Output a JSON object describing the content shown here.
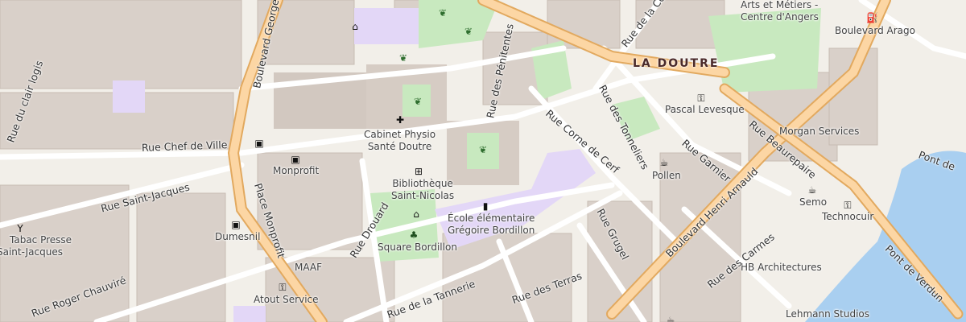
{
  "map": {
    "district": "LA DOUTRE",
    "places": [
      {
        "id": "arts",
        "lines": [
          "Arts et Métiers -",
          "Centre d'Angers"
        ]
      },
      {
        "id": "arago",
        "lines": [
          "Boulevard Arago"
        ]
      },
      {
        "id": "levesque",
        "lines": [
          "Pascal Levesque"
        ]
      },
      {
        "id": "morgan",
        "lines": [
          "Morgan Services"
        ]
      },
      {
        "id": "pollen",
        "lines": [
          "Pollen"
        ]
      },
      {
        "id": "semo",
        "lines": [
          "Semo"
        ]
      },
      {
        "id": "technocuir",
        "lines": [
          "Technocuir"
        ]
      },
      {
        "id": "hb",
        "lines": [
          "HB Architectures"
        ]
      },
      {
        "id": "lehmann",
        "lines": [
          "Lehmann Studios"
        ]
      },
      {
        "id": "cabinet",
        "lines": [
          "Cabinet Physio",
          "Santé Doutre"
        ]
      },
      {
        "id": "monprofit",
        "lines": [
          "Monprofit"
        ]
      },
      {
        "id": "bibliotheque",
        "lines": [
          "Bibliothèque",
          "Saint-Nicolas"
        ]
      },
      {
        "id": "ecole",
        "lines": [
          "École élémentaire",
          "Grégoire Bordillon"
        ]
      },
      {
        "id": "square",
        "lines": [
          "Square Bordillon"
        ]
      },
      {
        "id": "dumesnil",
        "lines": [
          "Dumesnil"
        ]
      },
      {
        "id": "tabac",
        "lines": [
          "Tabac Presse",
          "Saint-Jacques"
        ]
      },
      {
        "id": "maaf",
        "lines": [
          "MAAF"
        ]
      },
      {
        "id": "atout",
        "lines": [
          "Atout Service"
        ]
      }
    ],
    "streets": [
      {
        "id": "bd-georges",
        "name": "Boulevard Georges"
      },
      {
        "id": "chef-de-ville",
        "name": "Rue Chef de Ville"
      },
      {
        "id": "saint-jacques",
        "name": "Rue Saint-Jacques"
      },
      {
        "id": "place-monprofit",
        "name": "Place Monprofit"
      },
      {
        "id": "drouard",
        "name": "Rue Drouard"
      },
      {
        "id": "chauvire",
        "name": "Rue Roger Chauviré"
      },
      {
        "id": "tannerie",
        "name": "Rue de la Tannerie"
      },
      {
        "id": "terras",
        "name": "Rue des Terras"
      },
      {
        "id": "grugel",
        "name": "Rue Grugel"
      },
      {
        "id": "penitentes",
        "name": "Rue des Pénitentes"
      },
      {
        "id": "corne-de-cerf",
        "name": "Rue Corne de Cerf"
      },
      {
        "id": "tonneliers",
        "name": "Rue des Tonneliers"
      },
      {
        "id": "garnier",
        "name": "Rue Garnier"
      },
      {
        "id": "bd-henri-arnauld",
        "name": "Boulevard Henri Arnauld"
      },
      {
        "id": "beaurepaire",
        "name": "Rue Beaurepaire"
      },
      {
        "id": "carmes",
        "name": "Rue des Carmes"
      },
      {
        "id": "pont-verdun",
        "name": "Pont de Verdun"
      },
      {
        "id": "pont-de",
        "name": "Pont de"
      },
      {
        "id": "rue-de-la-ce",
        "name": "Rue de la Cé"
      },
      {
        "id": "logis",
        "name": "Rue du clair logis"
      }
    ],
    "icons": [
      "tree-icon",
      "tree-icon",
      "tree-icon",
      "tree-icon",
      "tree-icon",
      "shop-icon",
      "fuel-icon",
      "shop-icon",
      "cafe-icon",
      "shop-icon",
      "medical-cross-icon",
      "bus-stop-icon",
      "library-icon",
      "school-icon",
      "playground-icon",
      "tree-icon",
      "bus-stop-icon",
      "bar-icon",
      "shop-icon",
      "cafe-icon",
      "bus-stop-icon",
      "cafe-icon"
    ]
  },
  "colors": {
    "background": "#f2efe9",
    "building": "#d9d0c9",
    "building_edge": "#c8bcb3",
    "park": "#c8e9bf",
    "school": "#e3d7f7",
    "water": "#a9cff0",
    "primary_road": "#fcd6a4",
    "primary_casing": "#e2a95f",
    "minor_road": "#ffffff"
  }
}
